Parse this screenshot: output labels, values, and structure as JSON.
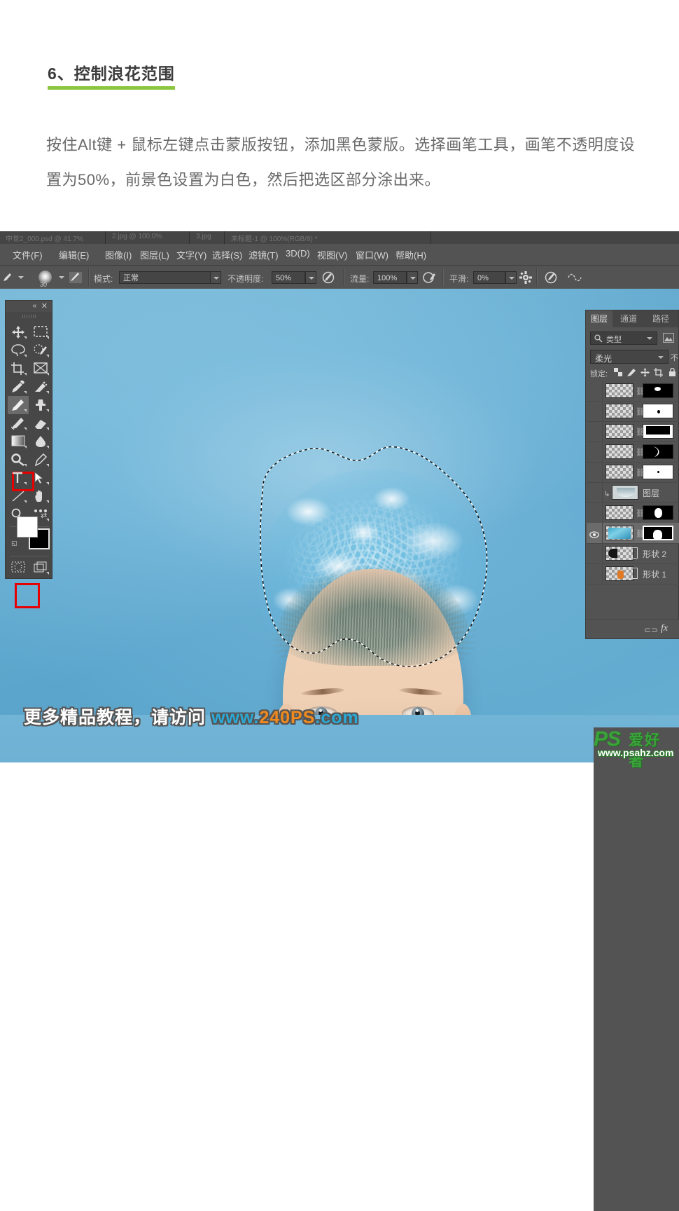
{
  "article": {
    "title": "6、控制浪花范围",
    "paragraph": "按住Alt键 + 鼠标左键点击蒙版按钮，添加黑色蒙版。选择画笔工具，画笔不透明度设置为50%，前景色设置为白色，然后把选区部分涂出来。"
  },
  "photoshop": {
    "tabbar": {
      "doc1": "中世2_000.psd @ 41.7%",
      "doc2": "2.jpg @ 100.0%",
      "doc3": "3.jpg",
      "doc4": "未标题-1 @ 100%(RGB/8) *"
    },
    "menu": [
      {
        "label": "文件(F)"
      },
      {
        "label": "编辑(E)"
      },
      {
        "label": "图像(I)"
      },
      {
        "label": "图层(L)"
      },
      {
        "label": "文字(Y)"
      },
      {
        "label": "选择(S)"
      },
      {
        "label": "滤镜(T)"
      },
      {
        "label": "3D(D)"
      },
      {
        "label": "视图(V)"
      },
      {
        "label": "窗口(W)"
      },
      {
        "label": "帮助(H)"
      }
    ],
    "options": {
      "brush_size": "30",
      "mode_label": "模式:",
      "mode_value": "正常",
      "opacity_label": "不透明度:",
      "opacity_value": "50%",
      "flow_label": "流量:",
      "flow_value": "100%",
      "smoothing_label": "平滑:",
      "smoothing_value": "0%",
      "highlight_color": "#e60000"
    },
    "toolbar": {
      "collapse": "«",
      "close": "✕",
      "tools": [
        "move-tool",
        "rectangular-marquee-tool",
        "lasso-tool",
        "quick-selection-tool",
        "crop-tool",
        "frame-tool",
        "eyedropper-tool",
        "spot-healing-brush-tool",
        "brush-tool",
        "clone-stamp-tool",
        "history-brush-tool",
        "eraser-tool",
        "gradient-tool",
        "blur-tool",
        "dodge-tool",
        "pen-tool",
        "type-tool",
        "path-selection-tool",
        "line-tool",
        "hand-tool",
        "zoom-tool",
        "edit-toolbar-tool"
      ],
      "active_tool": "brush-tool",
      "foreground_color": "#ffffff",
      "background_color": "#000000"
    },
    "layers_panel": {
      "tabs": [
        {
          "label": "图层",
          "active": true
        },
        {
          "label": "通道",
          "active": false
        },
        {
          "label": "路径",
          "active": false
        }
      ],
      "filter_value": "类型",
      "blend_mode": "柔光",
      "opacity_label": "不",
      "lock_label": "锁定:",
      "rows": [
        {
          "name": "",
          "visible": false,
          "mask": "black",
          "selected": false,
          "type": "pixel"
        },
        {
          "name": "",
          "visible": false,
          "mask": "white",
          "selected": false,
          "type": "pixel"
        },
        {
          "name": "",
          "visible": false,
          "mask": "black-bar",
          "selected": false,
          "type": "pixel"
        },
        {
          "name": "",
          "visible": false,
          "mask": "black-moon",
          "selected": false,
          "type": "pixel"
        },
        {
          "name": "",
          "visible": false,
          "mask": "white",
          "selected": false,
          "type": "pixel"
        },
        {
          "name": "图层",
          "visible": false,
          "mask": "none",
          "selected": false,
          "type": "clipped"
        },
        {
          "name": "",
          "visible": false,
          "mask": "black-blob",
          "selected": false,
          "type": "pixel"
        },
        {
          "name": "",
          "visible": true,
          "mask": "black-blob",
          "selected": true,
          "type": "pixel"
        },
        {
          "name": "形状 2",
          "visible": false,
          "mask": "none",
          "selected": false,
          "type": "shape"
        },
        {
          "name": "形状 1",
          "visible": false,
          "mask": "none",
          "selected": false,
          "type": "shape"
        }
      ],
      "bottom": {
        "link_icon": "⊂⊃",
        "fx_icon": "fx"
      }
    }
  },
  "watermark": {
    "prefix": "更多精品教程，请访问 ",
    "site_pre": "www.",
    "site_num": "240PS",
    "site_post": ".com"
  },
  "logo": {
    "ps": "PS",
    "cn": "爱好者",
    "url": "www.psahz.com"
  }
}
